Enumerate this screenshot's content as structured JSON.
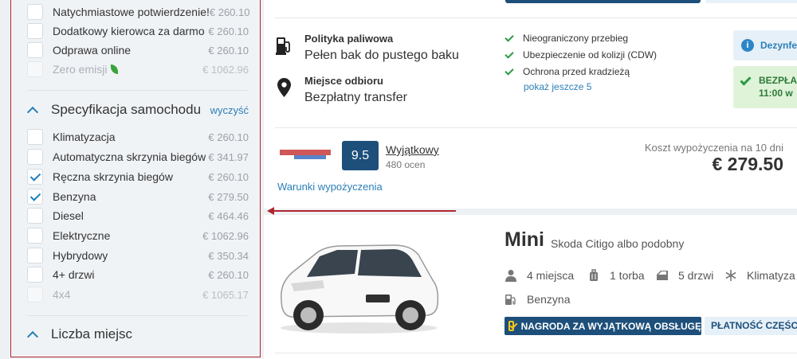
{
  "sidebar": {
    "group_top": [
      {
        "label": "Natychmiastowe potwierdzenie!",
        "price": "€ 260.10",
        "checked": false,
        "disabled": false
      },
      {
        "label": "Dodatkowy kierowca za darmo",
        "price": "€ 260.10",
        "checked": false,
        "disabled": false
      },
      {
        "label": "Odprawa online",
        "price": "€ 260.10",
        "checked": false,
        "disabled": false
      },
      {
        "label": "Zero emisji",
        "price": "€ 1062.96",
        "checked": false,
        "disabled": true
      }
    ],
    "spec_section": {
      "title": "Specyfikacja samochodu",
      "clear_label": "wyczyść",
      "items": [
        {
          "label": "Klimatyzacja",
          "price": "€ 260.10",
          "checked": false,
          "disabled": false
        },
        {
          "label": "Automatyczna skrzynia biegów",
          "price": "€ 341.97",
          "checked": false,
          "disabled": false
        },
        {
          "label": "Ręczna skrzynia biegów",
          "price": "€ 260.10",
          "checked": true,
          "disabled": false
        },
        {
          "label": "Benzyna",
          "price": "€ 279.50",
          "checked": true,
          "disabled": false
        },
        {
          "label": "Diesel",
          "price": "€ 464.46",
          "checked": false,
          "disabled": false
        },
        {
          "label": "Elektryczne",
          "price": "€ 1062.96",
          "checked": false,
          "disabled": false
        },
        {
          "label": "Hybrydowy",
          "price": "€ 350.34",
          "checked": false,
          "disabled": false
        },
        {
          "label": "4+ drzwi",
          "price": "€ 260.10",
          "checked": false,
          "disabled": false
        },
        {
          "label": "4x4",
          "price": "€ 1065.17",
          "checked": false,
          "disabled": true
        }
      ]
    },
    "seats_section": {
      "title": "Liczba miejsc"
    }
  },
  "offer1": {
    "fuel_policy_title": "Polityka paliwowa",
    "fuel_policy_value": "Pełen bak do pustego baku",
    "pickup_title": "Miejsce odbioru",
    "pickup_value": "Bezpłatny transfer",
    "features": [
      "Nieograniczony przebieg",
      "Ubezpieczenie od kolizji (CDW)",
      "Ochrona przed kradzieżą"
    ],
    "more_link": "pokaż jeszcze 5",
    "info_badge": "Dezynfe",
    "green_badge_line1": "BEZPŁA",
    "green_badge_line2": "11:00 w",
    "score": "9.5",
    "score_label": "Wyjątkowy",
    "score_count": "480 ocen",
    "rental_terms": "Warunki wypożyczenia",
    "cost_label": "Koszt wypożyczenia na 10 dni",
    "cost_value": "€ 279.50"
  },
  "offer2": {
    "car_name": "Mini",
    "car_model": "Skoda Citigo albo podobny",
    "specs": {
      "seats": "4 miejsca",
      "bags": "1 torba",
      "doors": "5 drzwi",
      "ac": "Klimatyza"
    },
    "fuel": "Benzyna",
    "badge_award": "NAGRODA ZA WYJĄTKOWĄ OBSŁUGĘ",
    "badge_payment": "PŁATNOŚĆ CZĘŚCI"
  },
  "colors": {
    "accent": "#2a7fb8",
    "dark_blue": "#1d4f7a",
    "highlight_red": "#b0262e",
    "green": "#2c9a45"
  }
}
